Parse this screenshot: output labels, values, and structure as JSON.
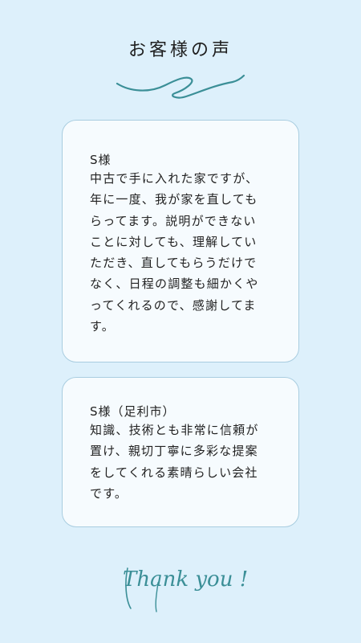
{
  "header": {
    "title": "お客様の声"
  },
  "colors": {
    "background": "#ddf0fb",
    "card_background": "#f6fbfe",
    "card_border": "#a9cde0",
    "accent": "#3b8f97"
  },
  "testimonials": [
    {
      "name": "S様",
      "lines": [
        "中古で手に入れた家ですが、",
        "年に一度、我が家を直しても",
        "らってます。説明ができない",
        "ことに対しても、理解してい",
        "ただき、直してもらうだけで",
        "なく、日程の調整も細かくや",
        "ってくれるので、感謝してま",
        "す。"
      ]
    },
    {
      "name": "S様（足利市）",
      "lines": [
        "知識、技術とも非常に信頼が",
        "置け、親切丁寧に多彩な提案",
        "をしてくれる素晴らしい会社",
        "です。"
      ]
    }
  ],
  "footer": {
    "thanks": "Thank you !"
  }
}
